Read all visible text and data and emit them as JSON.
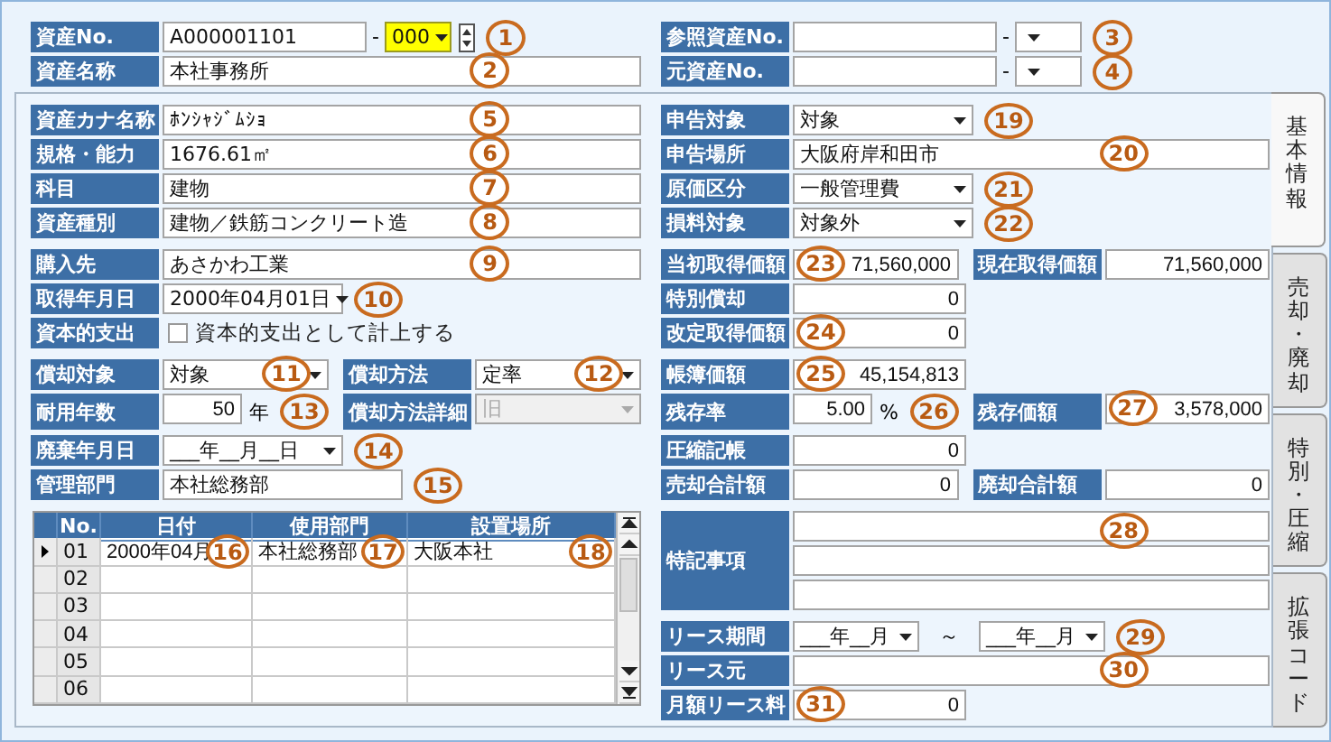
{
  "header": {
    "left": [
      {
        "kind": "assetno",
        "label": "資産No.",
        "value": "A000001101",
        "separator": "-",
        "branch": "000",
        "focused": true,
        "spinner": true,
        "callout": "1"
      },
      {
        "kind": "text",
        "label": "資産名称",
        "value": "本社事務所",
        "callout": "2"
      }
    ],
    "right": [
      {
        "kind": "assetno",
        "label": "参照資産No.",
        "separator": "-",
        "focused": false,
        "callout": "3"
      },
      {
        "kind": "assetno",
        "label": "元資産No.",
        "separator": "-",
        "focused": false,
        "callout": "4"
      }
    ]
  },
  "left_groups": [
    [
      [
        {
          "kind": "text",
          "label": "資産カナ名称",
          "value": "ﾎﾝｼｬｼﾞﾑｼｮ",
          "callout": "5"
        }
      ],
      [
        {
          "kind": "text",
          "label": "規格・能力",
          "value": "1676.61㎡",
          "callout": "6"
        }
      ],
      [
        {
          "kind": "text",
          "label": "科目",
          "value": "建物",
          "callout": "7"
        }
      ],
      [
        {
          "kind": "text",
          "label": "資産種別",
          "value": "建物／鉄筋コンクリート造",
          "callout": "8"
        }
      ]
    ],
    [
      [
        {
          "kind": "text",
          "label": "購入先",
          "value": "あさかわ工業",
          "callout": "9"
        }
      ],
      [
        {
          "kind": "select",
          "label": "取得年月日",
          "value": "2000年04月01日",
          "disabled": false,
          "callout": "10"
        }
      ],
      [
        {
          "kind": "checkbox",
          "label": "資本的支出",
          "text": "資本的支出として計上する",
          "checked": false
        }
      ]
    ],
    [
      [
        {
          "kind": "select",
          "label": "償却対象",
          "value": "対象",
          "disabled": false,
          "callout": "11"
        },
        {
          "kind": "select",
          "label": "償却方法",
          "value": "定率",
          "disabled": false,
          "callout": "12"
        }
      ],
      [
        {
          "kind": "number",
          "label": "耐用年数",
          "value": "50",
          "unit": "年",
          "callout": "13"
        },
        {
          "kind": "select",
          "label": "償却方法詳細",
          "value": "旧",
          "disabled": true
        }
      ]
    ],
    [
      [
        {
          "kind": "select",
          "label": "廃棄年月日",
          "value": "___年__月__日",
          "disabled": false,
          "callout": "14"
        }
      ],
      [
        {
          "kind": "short",
          "label": "管理部門",
          "value": "本社総務部",
          "callout": "15"
        }
      ]
    ]
  ],
  "grid": {
    "columns": [
      "No.",
      "日付",
      "使用部門",
      "設置場所"
    ],
    "rows": [
      {
        "no": "01",
        "selected": true,
        "cells": [
          {
            "text": "2000年04月",
            "callout": "16"
          },
          {
            "text": "本社総務部",
            "callout": "17"
          },
          {
            "text": "大阪本社",
            "callout": "18"
          }
        ]
      },
      {
        "no": "02",
        "selected": false
      },
      {
        "no": "03",
        "selected": false
      },
      {
        "no": "04",
        "selected": false
      },
      {
        "no": "05",
        "selected": false
      },
      {
        "no": "06",
        "selected": false
      }
    ]
  },
  "right_groups": [
    [
      [
        {
          "kind": "select",
          "label": "申告対象",
          "value": "対象",
          "disabled": false,
          "callout": "19"
        }
      ],
      [
        {
          "kind": "text",
          "label": "申告場所",
          "value": "大阪府岸和田市",
          "callout": "20"
        }
      ],
      [
        {
          "kind": "select",
          "label": "原価区分",
          "value": "一般管理費",
          "disabled": false,
          "callout": "21"
        }
      ],
      [
        {
          "kind": "select",
          "label": "損料対象",
          "value": "対象外",
          "disabled": false,
          "callout": "22"
        }
      ]
    ],
    [
      [
        {
          "kind": "amount",
          "label": "当初取得価額",
          "value": "71,560,000",
          "callout": "23"
        },
        {
          "kind": "amount",
          "label": "現在取得価額",
          "value": "71,560,000"
        }
      ],
      [
        {
          "kind": "amount",
          "label": "特別償却",
          "value": "0"
        }
      ],
      [
        {
          "kind": "amount",
          "label": "改定取得価額",
          "value": "0",
          "callout": "24"
        }
      ]
    ],
    [
      [
        {
          "kind": "amount",
          "label": "帳簿価額",
          "value": "45,154,813",
          "callout": "25"
        }
      ],
      [
        {
          "kind": "number",
          "label": "残存率",
          "value": "5.00",
          "unit": "%",
          "callout": "26"
        },
        {
          "kind": "amount",
          "label": "残存価額",
          "value": "3,578,000",
          "callout": "27"
        }
      ]
    ],
    [
      [
        {
          "kind": "amount",
          "label": "圧縮記帳",
          "value": "0"
        }
      ],
      [
        {
          "kind": "amount",
          "label": "売却合計額",
          "value": "0"
        },
        {
          "kind": "amount",
          "label": "廃却合計額",
          "value": "0"
        }
      ]
    ],
    [
      [
        {
          "kind": "memo",
          "label": "特記事項",
          "callout": "28"
        }
      ]
    ],
    [
      [
        {
          "kind": "range",
          "label": "リース期間",
          "from": "___年__月",
          "separator": "～",
          "to": "___年__月",
          "callout": "29"
        }
      ],
      [
        {
          "kind": "text",
          "label": "リース元",
          "callout": "30"
        }
      ],
      [
        {
          "kind": "amount",
          "label": "月額リース料",
          "value": "0",
          "callout": "31"
        }
      ]
    ]
  ],
  "tabs": [
    {
      "label": "基本情報",
      "selected": true
    },
    {
      "label": "売却・廃却",
      "selected": false
    },
    {
      "label": "特別・圧縮",
      "selected": false
    },
    {
      "label": "拡張コード",
      "selected": false
    }
  ]
}
